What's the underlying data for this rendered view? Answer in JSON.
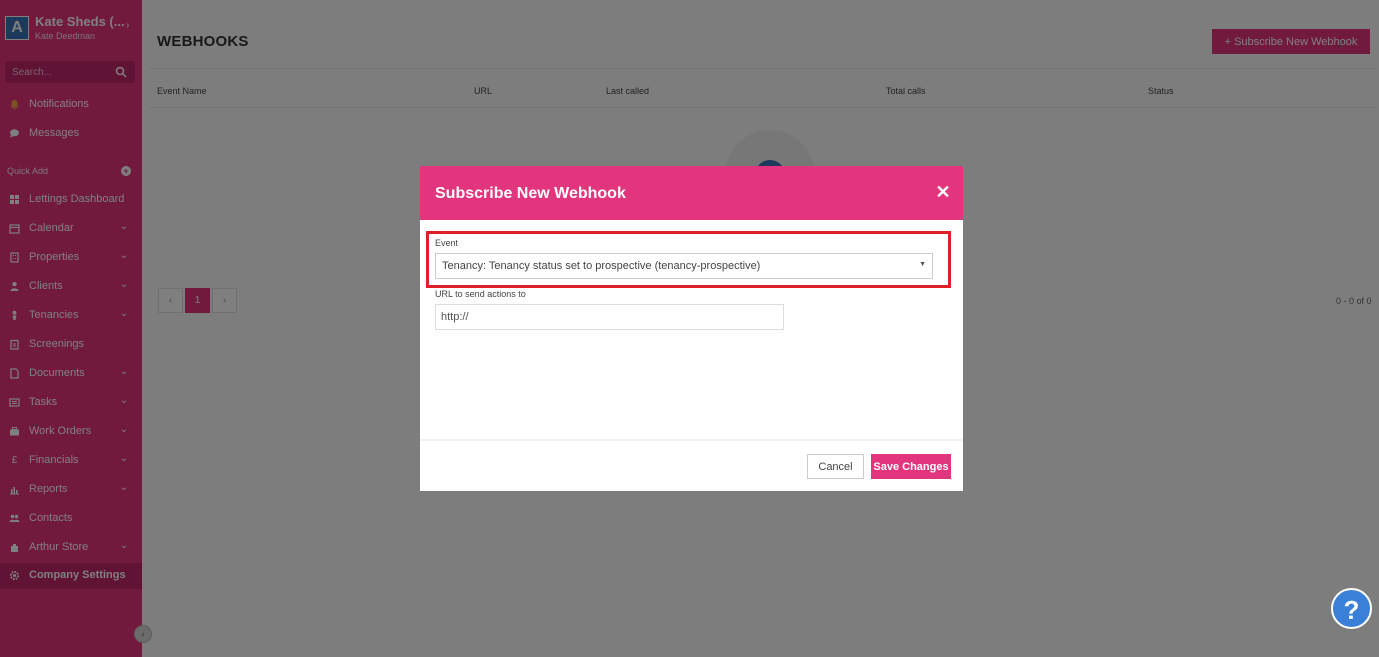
{
  "sidebar": {
    "org_name": "Kate Sheds (...",
    "user_name": "Kate Deedman",
    "logo_letter": "A",
    "search_placeholder": "Search...",
    "quick_add_label": "Quick Add",
    "top_items": [
      {
        "label": "Notifications",
        "icon": "bell-icon"
      },
      {
        "label": "Messages",
        "icon": "chat-icon"
      }
    ],
    "items": [
      {
        "label": "Lettings Dashboard",
        "icon": "dashboard-icon",
        "has_chevron": false
      },
      {
        "label": "Calendar",
        "icon": "calendar-icon",
        "has_chevron": true
      },
      {
        "label": "Properties",
        "icon": "building-icon",
        "has_chevron": true
      },
      {
        "label": "Clients",
        "icon": "person-icon",
        "has_chevron": true
      },
      {
        "label": "Tenancies",
        "icon": "key-person-icon",
        "has_chevron": true
      },
      {
        "label": "Screenings",
        "icon": "clipboard-icon",
        "has_chevron": false
      },
      {
        "label": "Documents",
        "icon": "document-icon",
        "has_chevron": true
      },
      {
        "label": "Tasks",
        "icon": "tasks-icon",
        "has_chevron": true
      },
      {
        "label": "Work Orders",
        "icon": "briefcase-icon",
        "has_chevron": true
      },
      {
        "label": "Financials",
        "icon": "pound-icon",
        "has_chevron": true
      },
      {
        "label": "Reports",
        "icon": "bar-chart-icon",
        "has_chevron": true
      },
      {
        "label": "Contacts",
        "icon": "contacts-icon",
        "has_chevron": false
      },
      {
        "label": "Arthur Store",
        "icon": "puzzle-icon",
        "has_chevron": true
      },
      {
        "label": "Company Settings",
        "icon": "gear-icon",
        "has_chevron": false,
        "active": true
      }
    ]
  },
  "main": {
    "title": "WEBHOOKS",
    "subscribe_button": "+ Subscribe New Webhook",
    "columns": [
      "Event Name",
      "URL",
      "Last called",
      "Total calls",
      "Status"
    ],
    "pagination": {
      "current_page": "1",
      "count_text": "0 - 0 of 0"
    }
  },
  "modal": {
    "title": "Subscribe New Webhook",
    "event_label": "Event",
    "event_value": "Tenancy: Tenancy status set to prospective (tenancy-prospective)",
    "url_label": "URL to send actions to",
    "url_value": "http://",
    "cancel_label": "Cancel",
    "save_label": "Save Changes",
    "highlight_color": "#e02028"
  },
  "help": {
    "label": "?"
  },
  "colors": {
    "brand": "#e2357d",
    "brand_dark": "#c2276a",
    "help": "#3a80d9"
  }
}
